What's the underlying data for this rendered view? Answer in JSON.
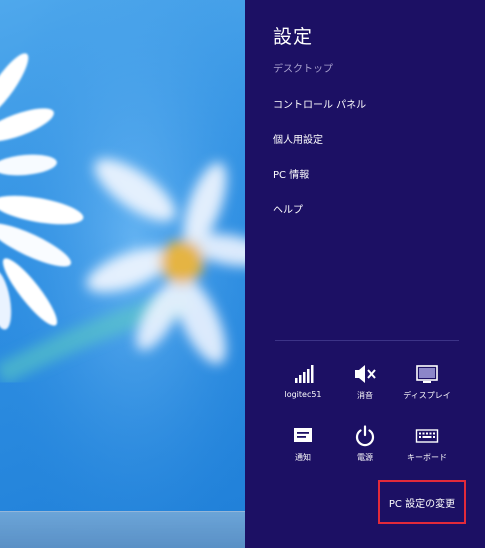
{
  "charm": {
    "title": "設定",
    "context": "デスクトップ",
    "menu_items": [
      "コントロール パネル",
      "個人用設定",
      "PC 情報",
      "ヘルプ"
    ],
    "quick_settings": [
      {
        "label": "logitec51",
        "icon": "wifi-signal-icon"
      },
      {
        "label": "消音",
        "icon": "volume-muted-icon"
      },
      {
        "label": "ディスプレイ",
        "icon": "display-icon"
      },
      {
        "label": "通知",
        "icon": "notifications-icon"
      },
      {
        "label": "電源",
        "icon": "power-icon"
      },
      {
        "label": "キーボード",
        "icon": "keyboard-icon"
      }
    ],
    "pc_settings_label": "PC 設定の変更"
  },
  "colors": {
    "charm_background": "#1c1064",
    "highlight_border": "#e22a3a",
    "context_text": "#a9a2cf",
    "wallpaper_blue": "#2f8fe2"
  }
}
